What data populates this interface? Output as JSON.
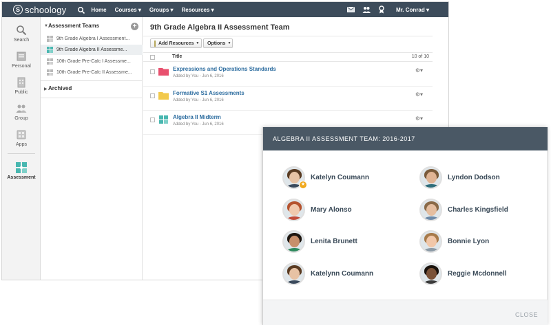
{
  "topbar": {
    "logo_text": "schoology",
    "nav": [
      "Home",
      "Courses ▾",
      "Groups ▾",
      "Resources ▾"
    ],
    "user": "Mr. Conrad ▾",
    "icons": [
      "search-icon",
      "mail-icon",
      "people-icon",
      "award-icon"
    ]
  },
  "rail": {
    "items": [
      {
        "label": "Search",
        "icon": "search-icon"
      },
      {
        "label": "Personal",
        "icon": "personal-icon"
      },
      {
        "label": "Public",
        "icon": "public-icon"
      },
      {
        "label": "Group",
        "icon": "group-icon"
      },
      {
        "label": "Apps",
        "icon": "apps-icon"
      },
      {
        "label": "Assessment",
        "icon": "assessment-icon"
      }
    ]
  },
  "groups": {
    "header": "Assessment Teams",
    "items": [
      {
        "label": "9th Grade Algebra I Assessment..."
      },
      {
        "label": "9th Grade Algebra II Assessme..."
      },
      {
        "label": "10th Grade Pre-Calc I Assessme..."
      },
      {
        "label": "10th Grade Pre-Calc II Assessme..."
      }
    ],
    "archived": "Archived"
  },
  "main": {
    "title": "9th Grade Algebra II Assessment Team",
    "add_resources": "Add Resources",
    "options": "Options",
    "col_title": "Title",
    "count": "10 of 10",
    "rows": [
      {
        "title": "Expressions and Operations Standards",
        "meta": "Added by You - Jun 6, 2016",
        "icon": "folder-icon",
        "color": "#e8506e"
      },
      {
        "title": "Formative S1 Assessments",
        "meta": "Added by You - Jun 6, 2016",
        "icon": "folder-icon",
        "color": "#f2c94c"
      },
      {
        "title": "Algebra II Midterm",
        "meta": "Added by You - Jun 6, 2016",
        "icon": "assessment-icon",
        "color": "#48b7b0"
      }
    ]
  },
  "modal": {
    "title": "ALGEBRA II ASSESSMENT TEAM: 2016-2017",
    "close": "CLOSE",
    "members": [
      {
        "name": "Katelyn Coumann",
        "skin": "#e7c2a4",
        "hair": "#5a3b22",
        "shirt": "#3b4a5c",
        "badge": true
      },
      {
        "name": "Lyndon Dodson",
        "skin": "#e0b494",
        "hair": "#7a5a3a",
        "shirt": "#2f6d7a",
        "badge": false
      },
      {
        "name": "Mary Alonso",
        "skin": "#f0c9ae",
        "hair": "#b5532f",
        "shirt": "#c24c3a",
        "badge": false
      },
      {
        "name": "Charles Kingsfield",
        "skin": "#e5bea0",
        "hair": "#8a6a48",
        "shirt": "#6e8aa8",
        "badge": false
      },
      {
        "name": "Lenita Brunett",
        "skin": "#c88f6b",
        "hair": "#1e1610",
        "shirt": "#2e8a5e",
        "badge": false
      },
      {
        "name": "Bonnie Lyon",
        "skin": "#f1c7a9",
        "hair": "#a77a4a",
        "shirt": "#8c9aa6",
        "badge": false
      },
      {
        "name": "Katelynn Coumann",
        "skin": "#e7c2a4",
        "hair": "#5a3b22",
        "shirt": "#3b4a5c",
        "badge": false
      },
      {
        "name": "Reggie Mcdonnell",
        "skin": "#7a5238",
        "hair": "#1a120c",
        "shirt": "#3b3b3b",
        "badge": false
      }
    ]
  }
}
